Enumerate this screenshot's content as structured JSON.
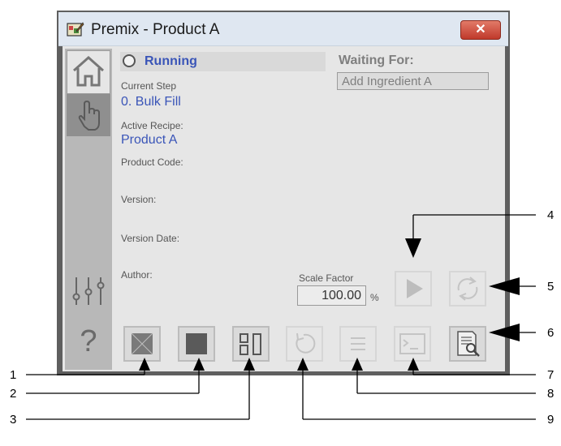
{
  "window": {
    "title": "Premix - Product A",
    "close_glyph": "✕"
  },
  "sidebar": {
    "items": [
      {
        "name": "home-icon"
      },
      {
        "name": "hand-icon"
      },
      {
        "name": "sliders-icon"
      },
      {
        "name": "help-icon",
        "glyph": "?"
      }
    ]
  },
  "status": {
    "state": "Running",
    "current_step_label": "Current Step",
    "current_step_value": "0. Bulk Fill",
    "active_recipe_label": "Active Recipe:",
    "active_recipe_value": "Product A",
    "product_code_label": "Product Code:",
    "version_label": "Version:",
    "version_date_label": "Version Date:",
    "author_label": "Author:"
  },
  "waiting": {
    "label": "Waiting For:",
    "value": "Add Ingredient A"
  },
  "scale": {
    "label": "Scale Factor",
    "value": "100.00",
    "unit": "%"
  },
  "toolbar": [
    {
      "name": "abort-button"
    },
    {
      "name": "stop-button"
    },
    {
      "name": "layout-button"
    },
    {
      "name": "restart-button"
    },
    {
      "name": "list-button"
    },
    {
      "name": "terminal-button"
    },
    {
      "name": "report-button"
    },
    {
      "name": "start-button"
    },
    {
      "name": "reset-button"
    }
  ],
  "callouts": [
    "1",
    "2",
    "3",
    "4",
    "5",
    "6",
    "7",
    "8",
    "9"
  ],
  "colors": {
    "accent_text": "#3a55b8",
    "frame": "#5f5f5f",
    "panel": "#e6e6e6",
    "close_button": "#c0392b"
  }
}
